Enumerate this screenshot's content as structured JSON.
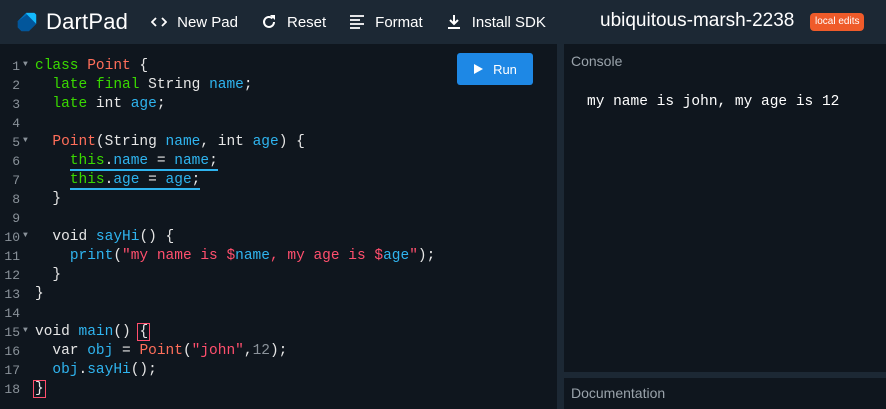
{
  "app": {
    "name": "DartPad",
    "logo_icon": "dart-logo-icon"
  },
  "toolbar": {
    "new_pad": {
      "label": "New Pad",
      "icon": "code-brackets-icon"
    },
    "reset": {
      "label": "Reset",
      "icon": "refresh-icon"
    },
    "format": {
      "label": "Format",
      "icon": "align-lines-icon"
    },
    "install_sdk": {
      "label": "Install SDK",
      "icon": "download-icon"
    }
  },
  "gist": {
    "title": "ubiquitous-marsh-2238",
    "badge": "local edits"
  },
  "editor": {
    "run_label": "Run",
    "run_icon": "play-icon",
    "line_numbers": [
      "1",
      "2",
      "3",
      "4",
      "5",
      "6",
      "7",
      "8",
      "9",
      "10",
      "11",
      "12",
      "13",
      "14",
      "15",
      "16",
      "17",
      "18"
    ],
    "lines": [
      "class Point {",
      "  late final String name;",
      "  late int age;",
      "",
      "  Point(String name, int age) {",
      "    this.name = name;",
      "    this.age = age;",
      "  }",
      "",
      "  void sayHi() {",
      "    print(\"my name is $name, my age is $age\");",
      "  }",
      "}",
      "",
      "void main() {",
      "  var obj = Point(\"john\",12);",
      "  obj.sayHi();",
      "}"
    ]
  },
  "console": {
    "title": "Console",
    "output": "my name is john, my age is 12"
  },
  "documentation": {
    "title": "Documentation"
  },
  "colors": {
    "accent": "#1e88e5",
    "badge": "#ef5b2a",
    "keyword": "#3ad900",
    "class": "#ff6e5a",
    "identifier": "#2fb4ef",
    "string": "#ff4f6d"
  }
}
